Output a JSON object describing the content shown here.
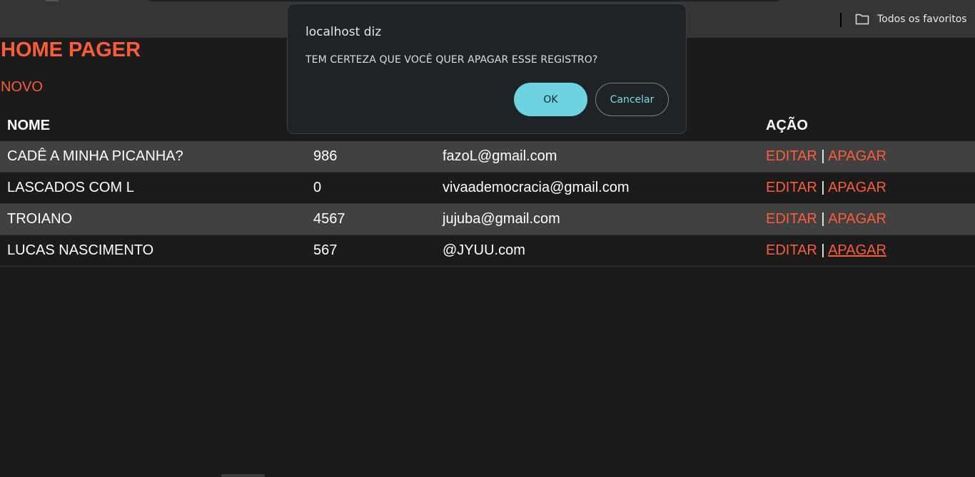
{
  "browser": {
    "bookmarks_label": "Todos os favoritos"
  },
  "page": {
    "title": "HOME PAGER",
    "new_link": "NOVO"
  },
  "table": {
    "headers": [
      "NOME",
      "",
      "",
      "AÇÃO"
    ],
    "rows": [
      {
        "nome": "CADÊ A MINHA PICANHA?",
        "numero": "986",
        "email": "fazoL@gmail.com",
        "editar": "EDITAR",
        "sep": "|",
        "apagar": "APAGAR"
      },
      {
        "nome": "LASCADOS COM L",
        "numero": "0",
        "email": "vivaademocracia@gmail.com",
        "editar": "EDITAR",
        "sep": "|",
        "apagar": "APAGAR"
      },
      {
        "nome": "TROIANO",
        "numero": "4567",
        "email": "jujuba@gmail.com",
        "editar": "EDITAR",
        "sep": "|",
        "apagar": "APAGAR"
      },
      {
        "nome": "LUCAS NASCIMENTO",
        "numero": "567",
        "email": "@JYUU.com",
        "editar": "EDITAR",
        "sep": "|",
        "apagar": "APAGAR"
      }
    ]
  },
  "dialog": {
    "title": "localhost diz",
    "message": "TEM CERTEZA QUE VOCÊ QUER APAGAR ESSE REGISTRO?",
    "ok_label": "OK",
    "cancel_label": "Cancelar"
  },
  "colors": {
    "accent": "#ff5c3a",
    "dialog_ok": "#6fd2e0",
    "background": "#1b1b1b",
    "row_alt": "#414141"
  }
}
